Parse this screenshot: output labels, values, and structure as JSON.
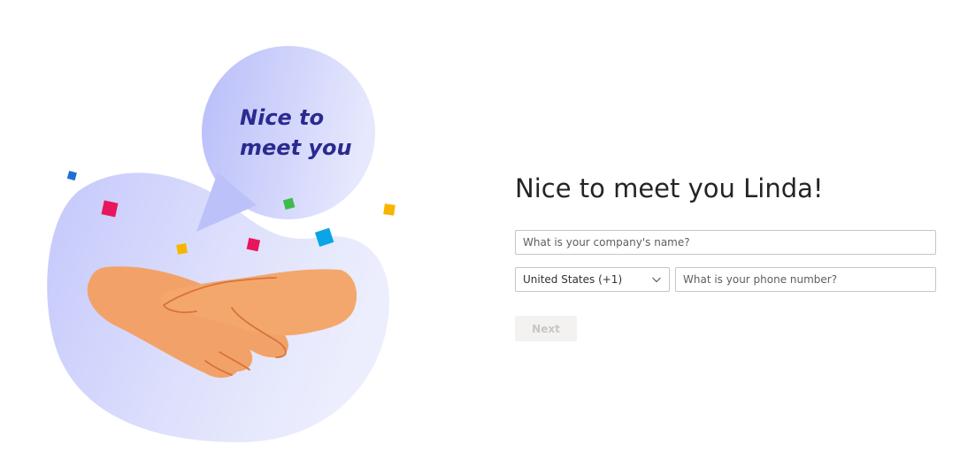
{
  "illustration": {
    "bubble_line1": "Nice to",
    "bubble_line2": "meet you"
  },
  "form": {
    "title": "Nice to meet you Linda!",
    "company": {
      "value": "",
      "placeholder": "What is your company's name?"
    },
    "country": {
      "selected": "United States (+1)"
    },
    "phone": {
      "value": "",
      "placeholder": "What is your phone number?"
    },
    "next_label": "Next"
  },
  "colors": {
    "blob": "#d6d9fb",
    "bubble": "#c3c8fa",
    "bubble_text": "#2b2a8f",
    "hands": "#f2a268",
    "hand_lines": "#d8733b",
    "disabled_button_bg": "#f3f2f1",
    "disabled_button_text": "#c8c6c4"
  }
}
